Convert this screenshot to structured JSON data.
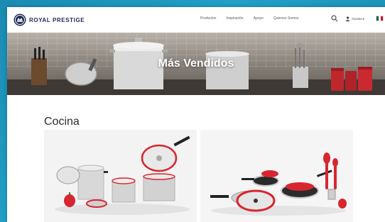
{
  "brand": {
    "name": "ROYAL PRESTIGE",
    "trademark": "®"
  },
  "nav": {
    "items": [
      {
        "label": "Productos"
      },
      {
        "label": "Inspiración"
      },
      {
        "label": "Apoyo"
      },
      {
        "label": "Quienes Somos"
      }
    ],
    "account_label": "Acceso",
    "search_icon": "search-icon",
    "user_icon": "user-icon",
    "language_icon": "mexico-flag-icon"
  },
  "hero": {
    "title": "Más Vendidos"
  },
  "section": {
    "title": "Cocina",
    "cards": [
      {
        "image": "cookware-set-image"
      },
      {
        "image": "pans-and-utensils-image"
      }
    ]
  },
  "colors": {
    "page_background": "#1b8bb3",
    "brand_navy": "#1e2a56",
    "accent_red": "#d7262f",
    "card_background": "#f1f1f1"
  }
}
